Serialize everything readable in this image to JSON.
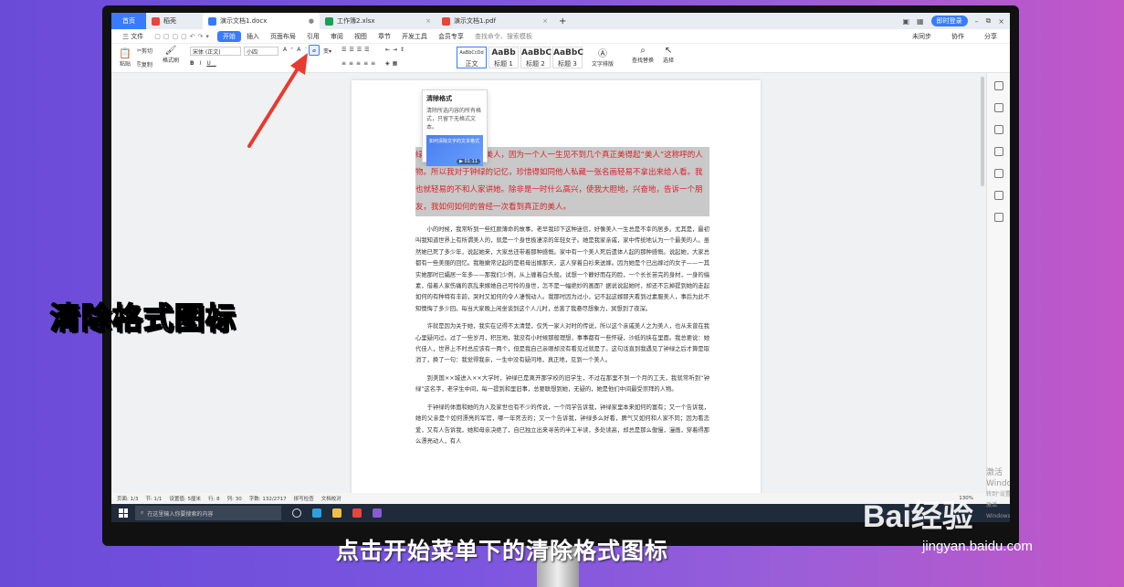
{
  "tabs": [
    {
      "label": "首页"
    },
    {
      "label": "稻壳",
      "color": "#e8453c"
    },
    {
      "label": "演示文档1.docx",
      "color": "#3a7bfd"
    },
    {
      "label": "工作簿2.xlsx",
      "color": "#1d9e55"
    },
    {
      "label": "演示文档1.pdf",
      "color": "#e8453c"
    }
  ],
  "login": "即时登录",
  "menu": {
    "file": "三 文件",
    "start": "开始",
    "items": [
      "插入",
      "页面布局",
      "引用",
      "审阅",
      "视图",
      "章节",
      "开发工具",
      "会员专享"
    ],
    "search": "查找命令、搜索模板",
    "right": [
      "未同步",
      "协作",
      "分享"
    ]
  },
  "ribbon": {
    "paste": "粘贴",
    "cut": "剪切",
    "copy": "复制",
    "format_painter": "格式刷",
    "font": "宋体 (正文)",
    "size": "小四",
    "styles": [
      {
        "sample": "AaBbCcDd",
        "name": "正文"
      },
      {
        "sample": "AaBb",
        "name": "标题 1"
      },
      {
        "sample": "AaBbC",
        "name": "标题 2"
      },
      {
        "sample": "AaBbC",
        "name": "标题 3"
      }
    ],
    "text_tools": "文字排版",
    "find_replace": "查找替换",
    "select": "选择"
  },
  "tooltip": {
    "title": "清除格式",
    "desc": "清除所选内容的所有格式，只留下无格式文本。",
    "video": "如何清除文字的文本格式",
    "duration": "01:11"
  },
  "document": {
    "poem": "绿是我记忆中第一个美人，因为一个人一生见不到几个真正美得起“美人”这称呼的人物。所以我对于钟绿的记忆，珍惜得如同他人私藏一张名画轻易不拿出来给人看。我也就轻易的不和人家讲她。除非是一时什么高兴，使我大胆地，兴奋地，告诉一个朋友，我如何如何的曾经一次看到真正的美人。",
    "paragraphs": [
      "小的时候，我常听到一些红颜薄命的故事，老早我印下这种迷信，好像美人一生总是不幸的居多。尤其是，最初叫我知道世界上有所谓美人的，就是一个身世极凄凉的年轻女子。她是我家亲戚，家中传统地认为一个最美的人。虽然她已死了多少年，说起她来，大家总还带着那种感慨。家中有一个美人死后遗体人起的那种感慨。说起她，大家总都有一些美丽的回忆。我稚嫩常记起的是祖母出嫁那天，这人穿着白衫来送嫁。因为她是个已出嫁过的女子——一其实她那时已孀居一年多——那我们少例，从上缠着白头般。试想一个静好而在的脸，一个长长苗完的身材，一身的缟素，借着人家伤痛的哀乱来嫁她自己可怜的身世，怎不是一幅绝妙的画面？据说说起她时，却还不忘掉提到她的走起如何的有种特有丰韵，哭时又如何的令人凄惋动人。我那时因为过小，记不起这嫁那天看到过素服美人，事后为此不知懊悔了多少回。每当大家晚上闲坐谈到这个人儿时，总害了我悬尽想象力，冥想到了夜深。",
      "许就是因为关于她，我实在记得不太清楚，仅凭一家人对时的传说，所以这个亲戚美人之为美人，也从未曾在我心里疑问过。过了一些岁月，积压地，我没有小时候那般理想，事事都有一些怀疑，沙纸的挟在里面。我总要说：她代佳人，世界上不时总应该有一两个，但是我自己亲眼却没有看见过就是了。这句话直到我遇见了钟绿之后才算是取消了，换了一句：我觉得我亲，一生中没有疑问地，真正地，见到一个美人。",
      "到美国××城进入××大学时，钟绿已是离开那学校的旧学生，不过在那里不到一个月的工夫，我就常听到“钟绿”这名字，老学生中间，每一提到和里旧事，总要联想到她，无疑的，她是他们中间最受崇拜的人物。",
      "于钟绿的体面和她的为人及家世也有不少的传说，一个同学告诉我，钟绿家里本来如何的富有；又一个告诉我，她的父亲是个如何漂亮的军官，哪一年死去的；又一个告诉我，钟绿多么好看，脾气又如何和人家不同；因为看恋爱，又有人告诉我，她和母亲决绝了，自已独立出来寻苦的半工半读，多处读高，却总是那么傲慢，漫画，穿着得那么漂亮动人，有人"
    ]
  },
  "status": {
    "page": "页面: 1/3",
    "section": "节: 1/1",
    "setting": "设置值: 5厘米",
    "row": "行: 8",
    "col": "列: 30",
    "words": "字数: 132/2717",
    "spell": "拼写检查",
    "doc_check": "文档校对",
    "zoom": "130%"
  },
  "taskbar": {
    "search": "在这里输入你要搜索的内容"
  },
  "activate": {
    "title": "激活 Windows",
    "sub": "转到\"设置\"以激活 Windows。"
  },
  "overlay_title": "清除格式图标",
  "caption": "点击开始菜单下的清除格式图标",
  "watermark": "Bai经验",
  "watermark_sub": "jingyan.baidu.com"
}
